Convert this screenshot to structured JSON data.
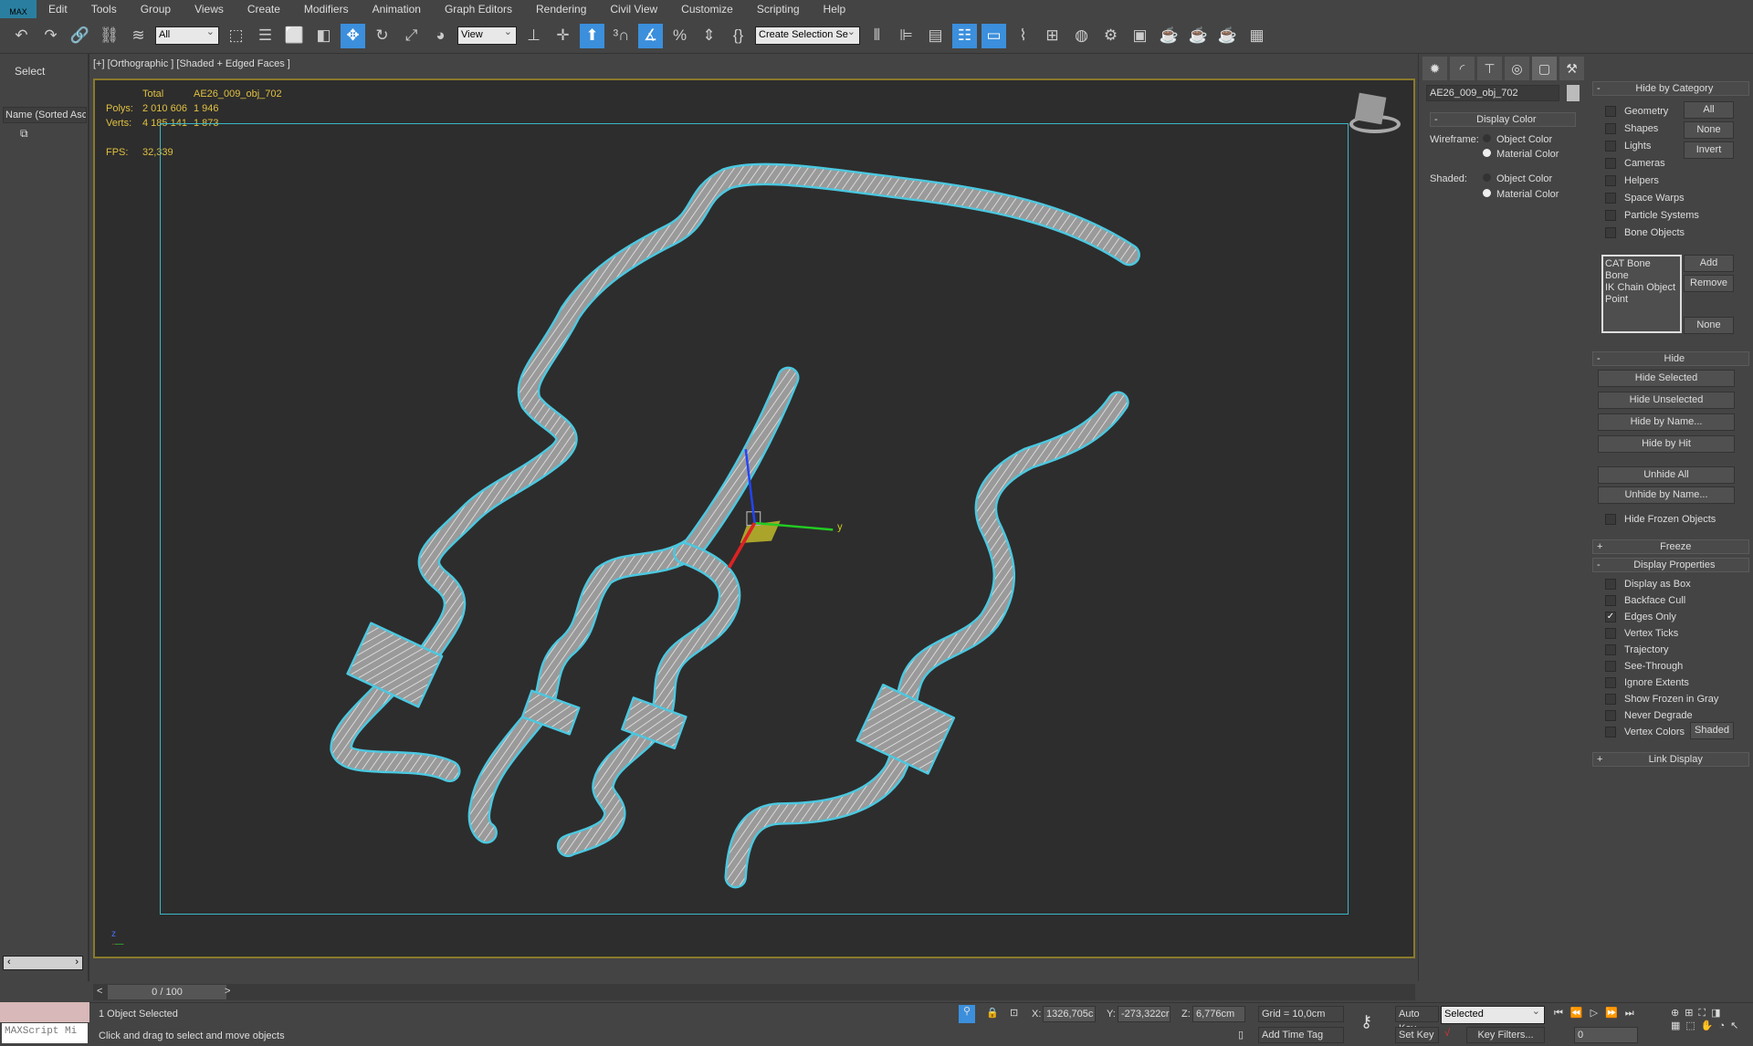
{
  "menu": [
    "Edit",
    "Tools",
    "Group",
    "Views",
    "Create",
    "Modifiers",
    "Animation",
    "Graph Editors",
    "Rendering",
    "Civil View",
    "Customize",
    "Scripting",
    "Help"
  ],
  "logo": "MAX",
  "toolbar": {
    "icons": [
      {
        "n": "undo-icon",
        "g": "↶"
      },
      {
        "n": "redo-icon",
        "g": "↷"
      },
      {
        "n": "link-icon",
        "g": "🔗"
      },
      {
        "n": "unlink-icon",
        "g": "⛓"
      },
      {
        "n": "bind-spacewarp-icon",
        "g": "≋"
      }
    ],
    "filter": "All",
    "icons2": [
      {
        "n": "select-object-icon",
        "g": "⬚"
      },
      {
        "n": "select-by-name-icon",
        "g": "☰"
      },
      {
        "n": "rect-selection-icon",
        "g": "⬜"
      },
      {
        "n": "window-crossing-icon",
        "g": "◧"
      },
      {
        "n": "move-icon",
        "g": "✥",
        "on": true
      },
      {
        "n": "rotate-icon",
        "g": "↻"
      },
      {
        "n": "scale-icon",
        "g": "⤢"
      },
      {
        "n": "place-icon",
        "g": "◕"
      }
    ],
    "ref_coord": "View",
    "icons3": [
      {
        "n": "pivot-icon",
        "g": "⊥"
      },
      {
        "n": "manipulate-icon",
        "g": "✛"
      },
      {
        "n": "keyboard-shortcut-icon",
        "g": "⬆",
        "on": true
      },
      {
        "n": "snap-3d-icon",
        "g": "³∩"
      },
      {
        "n": "angle-snap-icon",
        "g": "∡",
        "on": true
      },
      {
        "n": "percent-snap-icon",
        "g": "%"
      },
      {
        "n": "spinner-snap-icon",
        "g": "⇕"
      },
      {
        "n": "edit-named-sel-icon",
        "g": "{}"
      }
    ],
    "named_sel": "Create Selection Se",
    "icons4": [
      {
        "n": "mirror-icon",
        "g": "⫴"
      },
      {
        "n": "align-icon",
        "g": "⊫"
      },
      {
        "n": "layer-icon",
        "g": "▤"
      },
      {
        "n": "scene-explorer-icon",
        "g": "☷",
        "on": true
      },
      {
        "n": "ribbon-icon",
        "g": "▭",
        "on": true
      },
      {
        "n": "curve-editor-icon",
        "g": "⌇"
      },
      {
        "n": "schematic-icon",
        "g": "⊞"
      },
      {
        "n": "material-editor-icon",
        "g": "◍"
      },
      {
        "n": "render-setup-icon",
        "g": "⚙"
      },
      {
        "n": "rendered-frame-icon",
        "g": "▣"
      },
      {
        "n": "render-icon",
        "g": "☕"
      },
      {
        "n": "render-iterative-icon",
        "g": "☕"
      },
      {
        "n": "render-production-icon",
        "g": "☕"
      },
      {
        "n": "a360-icon",
        "g": "▦"
      }
    ]
  },
  "left": {
    "select": "Select",
    "column": "Name (Sorted Asc",
    "maxscript": "MAXScript Mi"
  },
  "viewport": {
    "label": "[+] [Orthographic ] [Shaded + Edged Faces ]",
    "stats": {
      "total": "Total",
      "object": "AE26_009_obj_702",
      "polys_label": "Polys:",
      "polys_total": "2 010 606",
      "polys_obj": "1 946",
      "verts_label": "Verts:",
      "verts_total": "4 185 141",
      "verts_obj": "1 873",
      "fps_label": "FPS:",
      "fps": "32,339"
    },
    "gizmo": {
      "y": "y"
    }
  },
  "cmd": {
    "object_name": "AE26_009_obj_702",
    "display_color": "Display Color",
    "wireframe": "Wireframe:",
    "shaded": "Shaded:",
    "object_color": "Object Color",
    "material_color": "Material Color",
    "hide_cat": "Hide by Category",
    "categories": [
      "Geometry",
      "Shapes",
      "Lights",
      "Cameras",
      "Helpers",
      "Space Warps",
      "Particle Systems",
      "Bone Objects"
    ],
    "cat_buttons": [
      "All",
      "None",
      "Invert"
    ],
    "bone_list": [
      "CAT Bone",
      "Bone",
      "IK Chain Object",
      "Point"
    ],
    "add": "Add",
    "remove": "Remove",
    "none": "None",
    "hide": "Hide",
    "hide_buttons": [
      "Hide Selected",
      "Hide Unselected",
      "Hide by Name...",
      "Hide by Hit"
    ],
    "unhide_buttons": [
      "Unhide All",
      "Unhide by Name..."
    ],
    "hide_frozen": "Hide Frozen Objects",
    "freeze": "Freeze",
    "display_props": "Display Properties",
    "props": [
      {
        "label": "Display as Box",
        "checked": false
      },
      {
        "label": "Backface Cull",
        "checked": false
      },
      {
        "label": "Edges Only",
        "checked": true
      },
      {
        "label": "Vertex Ticks",
        "checked": false
      },
      {
        "label": "Trajectory",
        "checked": false
      },
      {
        "label": "See-Through",
        "checked": false
      },
      {
        "label": "Ignore Extents",
        "checked": false
      },
      {
        "label": "Show Frozen in Gray",
        "checked": false
      },
      {
        "label": "Never Degrade",
        "checked": false
      },
      {
        "label": "Vertex Colors",
        "checked": false
      }
    ],
    "shaded_btn": "Shaded",
    "link_display": "Link Display"
  },
  "timeline": {
    "frame": "0 / 100",
    "prev": "<",
    "next": ">"
  },
  "status": {
    "selected": "1 Object Selected",
    "prompt": "Click and drag to select and move objects",
    "x_label": "X:",
    "x": "1326,705c",
    "y_label": "Y:",
    "y": "-273,322cr",
    "z_label": "Z:",
    "z": "6,776cm",
    "grid": "Grid = 10,0cm",
    "add_time_tag": "Add Time Tag",
    "auto_key": "Auto Key",
    "set_key": "Set Key",
    "key_mode": "Selected",
    "key_filters": "Key Filters...",
    "current_frame": "0"
  },
  "colors": {
    "accent": "#3b8fdc",
    "wire": "#39b8c8",
    "stats": "#e0c040",
    "viewport_border": "#8a7a2a"
  }
}
